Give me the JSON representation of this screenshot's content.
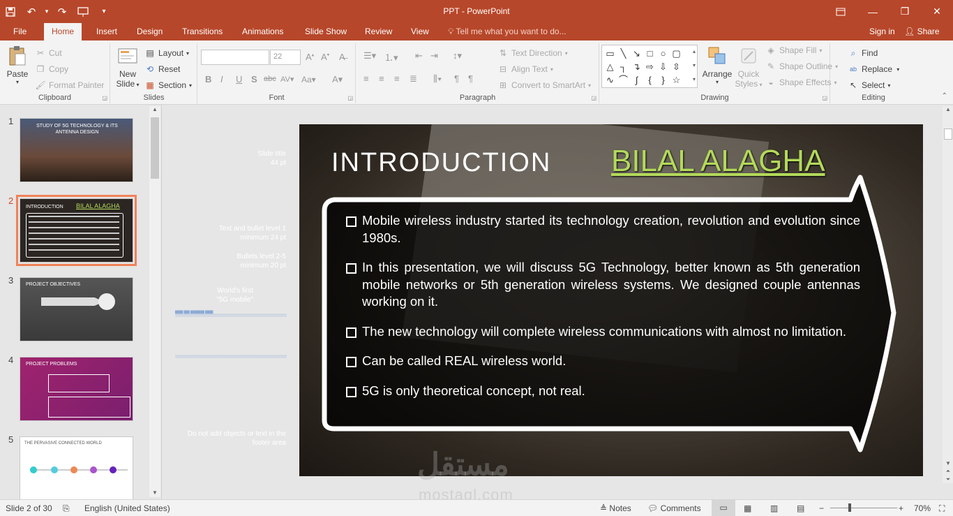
{
  "window": {
    "title": "PPT - PowerPoint"
  },
  "qat": {
    "save_icon": "save-icon",
    "undo_icon": "undo-icon",
    "redo_icon": "redo-icon",
    "present_icon": "present-icon"
  },
  "tabs": [
    {
      "label": "File"
    },
    {
      "label": "Home"
    },
    {
      "label": "Insert"
    },
    {
      "label": "Design"
    },
    {
      "label": "Transitions"
    },
    {
      "label": "Animations"
    },
    {
      "label": "Slide Show"
    },
    {
      "label": "Review"
    },
    {
      "label": "View"
    }
  ],
  "tellme": "Tell me what you want to do...",
  "account": {
    "signin": "Sign in",
    "share": "Share"
  },
  "ribbon": {
    "clipboard": {
      "label": "Clipboard",
      "paste": "Paste",
      "cut": "Cut",
      "copy": "Copy",
      "format_painter": "Format Painter"
    },
    "slides": {
      "label": "Slides",
      "new_slide_1": "New",
      "new_slide_2": "Slide",
      "layout": "Layout",
      "reset": "Reset",
      "section": "Section"
    },
    "font": {
      "label": "Font",
      "font_name": "",
      "font_size": "22"
    },
    "paragraph": {
      "label": "Paragraph",
      "text_direction": "Text Direction",
      "align_text": "Align Text",
      "convert_smartart": "Convert to SmartArt"
    },
    "drawing": {
      "label": "Drawing",
      "arrange": "Arrange",
      "quick_styles_1": "Quick",
      "quick_styles_2": "Styles",
      "shape_fill": "Shape Fill",
      "shape_outline": "Shape Outline",
      "shape_effects": "Shape Effects"
    },
    "editing": {
      "label": "Editing",
      "find": "Find",
      "replace": "Replace",
      "select": "Select"
    }
  },
  "thumbnails": [
    {
      "num": "1",
      "caption": "STUDY OF 5G TECHNOLOGY & ITS ANTENNA DESIGN"
    },
    {
      "num": "2",
      "caption": "INTRODUCTION",
      "caption2": "BILAL ALAGHA"
    },
    {
      "num": "3",
      "caption": "PROJECT OBJECTIVES"
    },
    {
      "num": "4",
      "caption": "PROJECT PROBLEMS"
    },
    {
      "num": "5",
      "caption": "THE PERVASIVE CONNECTED WORLD"
    }
  ],
  "notes_guides": {
    "slide_title_1": "Slide title",
    "slide_title_2": "44 pt",
    "text_bullet_1": "Text and bullet level 1",
    "text_bullet_2": "minimum 24 pt",
    "bullets_1": "Bullets level 2-5",
    "bullets_2": "minimum 20 pt",
    "worlds_first_1": "World's first",
    "worlds_first_2": "\"5G mobile\"",
    "footer_1": "Do not add objects or text in the",
    "footer_2": "footer area"
  },
  "slide": {
    "title": "INTRODUCTION",
    "author": "BILAL ALAGHA",
    "bullets": [
      "Mobile wireless industry started its technology creation, revolution and evolution since 1980s.",
      "In this presentation, we will discuss 5G Technology, better known as 5th generation mobile networks or 5th generation wireless systems. We designed couple antennas working on it.",
      "The new technology will complete wireless communications with almost no limitation.",
      "Can be called REAL wireless world.",
      "5G is only theoretical concept, not real."
    ]
  },
  "watermark": {
    "arabic": "مستقل",
    "latin": "mostaql.com"
  },
  "status": {
    "slide_info": "Slide 2 of 30",
    "language": "English (United States)",
    "notes": "Notes",
    "comments": "Comments",
    "zoom": "70%"
  },
  "colors": {
    "accent": "#b7472a",
    "author_green": "#b3d95a",
    "selected_thumb": "#f0825a"
  }
}
